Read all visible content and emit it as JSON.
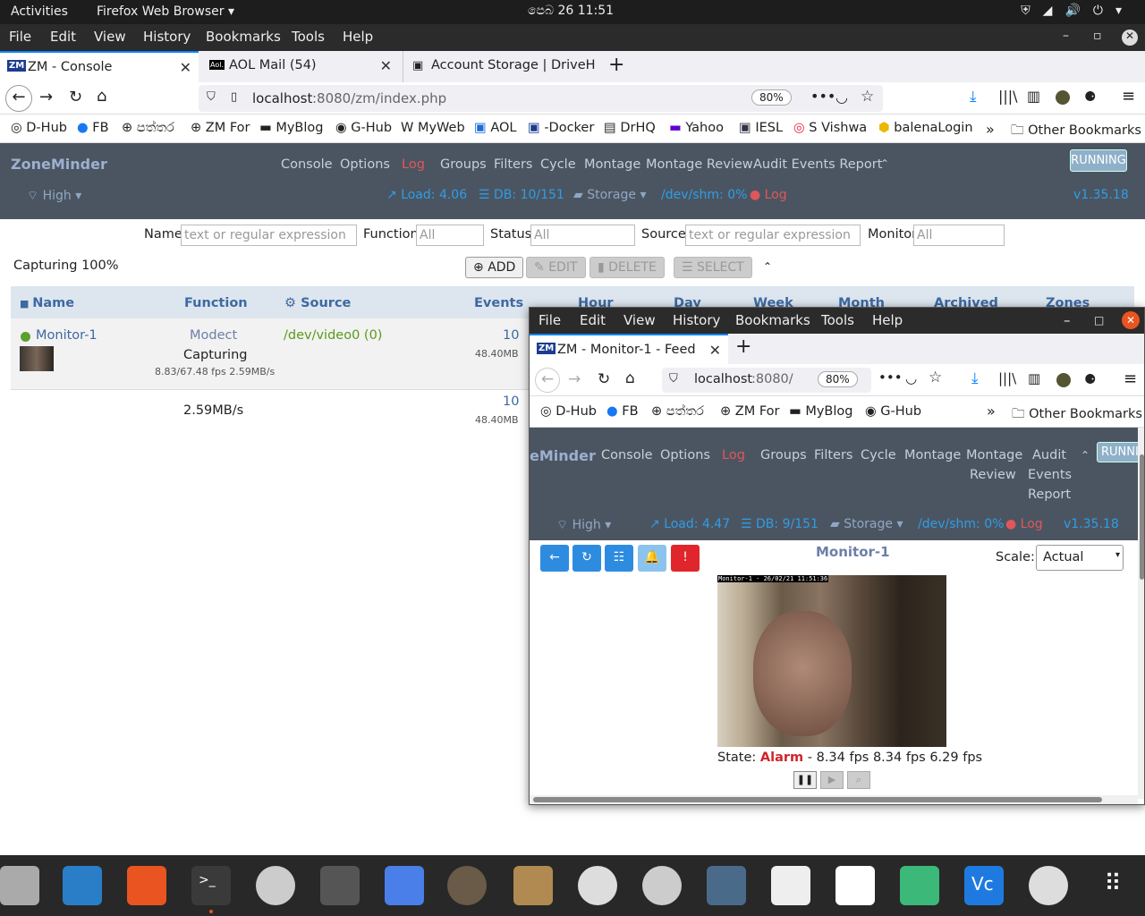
{
  "system": {
    "activities": "Activities",
    "app": "Firefox Web Browser ▾",
    "clock": "පෙබ 26  11:51"
  },
  "menu": {
    "file": "File",
    "edit": "Edit",
    "view": "View",
    "history": "History",
    "bookmarks": "Bookmarks",
    "tools": "Tools",
    "help": "Help"
  },
  "tabs": [
    {
      "label": "ZM - Console"
    },
    {
      "label": "AOL Mail (54)"
    },
    {
      "label": "Account Storage | DriveH"
    }
  ],
  "url": {
    "host": "localhost",
    "path": ":8080/zm/index.php",
    "zoom": "80%"
  },
  "bookmarks": [
    "D-Hub",
    "FB",
    "පත්තර",
    "ZM For",
    "MyBlog",
    "G-Hub",
    "MyWeb",
    "AOL",
    "-Docker",
    "DrHQ",
    "Yahoo",
    "IESL",
    "S Vishwa",
    "balenaLogin",
    "Other Bookmarks"
  ],
  "zm": {
    "brand": "ZoneMinder",
    "nav": [
      "Console",
      "Options",
      "Log",
      "Groups",
      "Filters",
      "Cycle",
      "Montage",
      "Montage Review",
      "Audit Events Report"
    ],
    "running": "RUNNING",
    "high": "High",
    "load": "Load: 4.06",
    "db": "DB: 10/151",
    "storage": "Storage",
    "shm": "/dev/shm: 0%",
    "log": "Log",
    "version": "v1.35.18"
  },
  "filter": {
    "name_label": "Name",
    "name_ph": "text or regular expression",
    "function_label": "Function",
    "function_val": "All",
    "status_label": "Status",
    "status_val": "All",
    "source_label": "Source",
    "source_ph": "text or regular expression",
    "monitor_label": "Monitor",
    "monitor_val": "All"
  },
  "capturing": "Capturing 100%",
  "actions": {
    "add": "ADD",
    "edit": "EDIT",
    "delete": "DELETE",
    "select": "SELECT"
  },
  "table": {
    "headers": [
      "Name",
      "Function",
      "Source",
      "Events",
      "Hour",
      "Day",
      "Week",
      "Month",
      "Archived",
      "Zones"
    ],
    "row": {
      "name": "Monitor-1",
      "function": "Modect",
      "status": "Capturing",
      "fps": "8.83/67.48 fps 2.59MB/s",
      "source": "/dev/video0 (0)",
      "events": "10",
      "size": "48.40MB"
    },
    "total": {
      "bw": "2.59MB/s",
      "events": "10",
      "size": "48.40MB"
    }
  },
  "popup": {
    "tab": "ZM - Monitor-1 - Feed",
    "url_host": "localhost",
    "url_path": ":8080/",
    "zoom": "80%",
    "bookmarks": [
      "D-Hub",
      "FB",
      "පත්තර",
      "ZM For",
      "MyBlog",
      "G-Hub",
      "Other Bookmarks"
    ],
    "brand": "eMinder",
    "nav": [
      "Console",
      "Options",
      "Log",
      "Groups",
      "Filters",
      "Cycle",
      "Montage",
      "Montage",
      "Review",
      "Audit",
      "Events",
      "Report"
    ],
    "running": "RUNNI",
    "high": "High",
    "load": "Load: 4.47",
    "db": "DB: 9/151",
    "storage": "Storage",
    "shm": "/dev/shm: 0%",
    "log": "Log",
    "version": "v1.35.18",
    "monitor": "Monitor-1",
    "scale_label": "Scale:",
    "scale_val": "Actual",
    "overlay": "Monitor-1 - 26/02/21 11:51:36",
    "state_label": "State:",
    "state": "Alarm",
    "fps": "- 8.34 fps 8.34 fps 6.29 fps"
  }
}
